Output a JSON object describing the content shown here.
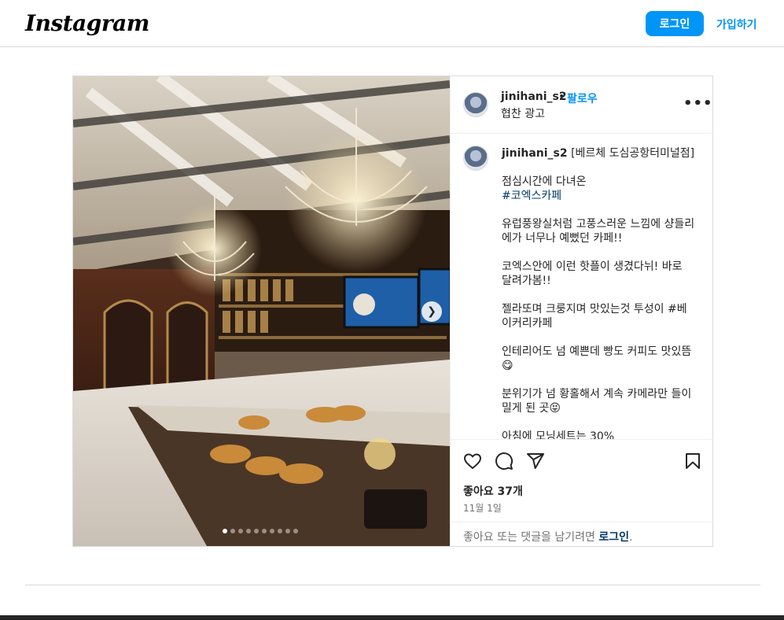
{
  "header": {
    "logo_text": "Instagram",
    "login_label": "로그인",
    "signup_label": "가입하기"
  },
  "post": {
    "username": "jinihani_s2",
    "separator": "•",
    "follow_label": "팔로우",
    "sponsored_label": "협찬 광고",
    "more_icon": "more-horizontal-icon",
    "caption": {
      "username": "jinihani_s2",
      "title": " [베르체 도심공항터미널점]",
      "lines": [
        "점심시간에 다녀온",
        "#코엑스카페",
        "유럽풍왕실처럼 고풍스러운 느낌에 샹들리에가 너무나 예뻤던 카페!!",
        "코엑스안에 이런 핫플이 생겼다뉘! 바로 달려가봄!!",
        "젤라또며 크룽지며 맛있는것 투성이 #베이커리카페",
        "인테리어도 넘 예쁜데 빵도 커피도 맛있뜸😋",
        "분위기가 넘 황홀해서 계속 카메라만 들이밀게 된 곳😝",
        "아침에 모닝세트는 30%"
      ]
    },
    "icons": [
      "heart-icon",
      "comment-icon",
      "share-icon",
      "bookmark-icon"
    ],
    "likes_text": "좋아요 37개",
    "date_text": "11월 1일",
    "prompt_text": "좋아요 또는 댓글을 남기려면 ",
    "prompt_login": "로그인",
    "prompt_end": ".",
    "carousel": {
      "total": 10,
      "active_index": 0
    }
  },
  "colors": {
    "accent": "#0095f6",
    "border": "#dbdbdb",
    "secondary_text": "#737373",
    "tag": "#00376b"
  }
}
